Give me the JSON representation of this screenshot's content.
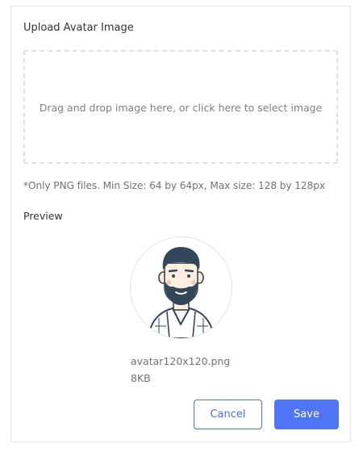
{
  "upload": {
    "title": "Upload Avatar Image",
    "dropzone_text": "Drag and drop image here, or click here to select image",
    "hint": "*Only PNG files. Min Size: 64 by 64px, Max size: 128 by 128px"
  },
  "preview": {
    "label": "Preview",
    "file_name": "avatar120x120.png",
    "file_size": "8KB",
    "avatar_icon": "bearded-man-avatar"
  },
  "actions": {
    "cancel_label": "Cancel",
    "save_label": "Save"
  },
  "colors": {
    "accent": "#4f74f5",
    "border": "#e4e7eb",
    "dashed_border": "#dde1e6",
    "muted_text": "#6c727b",
    "avatar_hair": "#34475a"
  }
}
